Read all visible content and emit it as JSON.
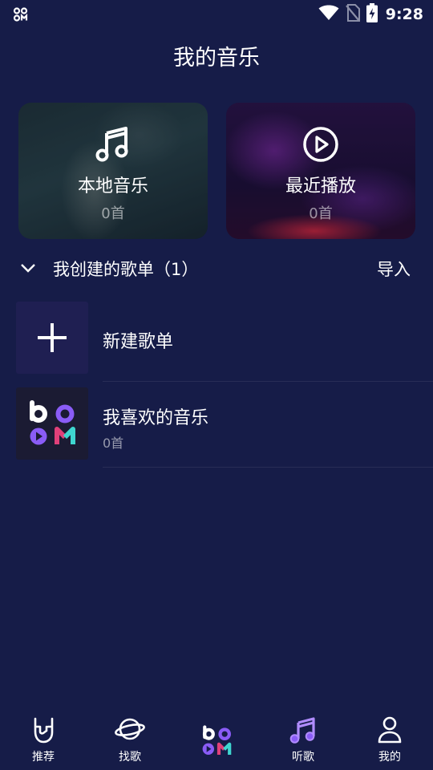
{
  "status_bar": {
    "time": "9:28",
    "icons": [
      "app-logo-icon",
      "wifi-icon",
      "no-sim-icon",
      "battery-charging-icon"
    ]
  },
  "page": {
    "title": "我的音乐"
  },
  "cards": [
    {
      "title": "本地音乐",
      "count": "0首",
      "icon": "music-note-icon"
    },
    {
      "title": "最近播放",
      "count": "0首",
      "icon": "play-circle-icon"
    }
  ],
  "section": {
    "title": "我创建的歌单（1）",
    "import_label": "导入",
    "icon": "chevron-down-icon"
  },
  "playlists": [
    {
      "title": "新建歌单",
      "icon": "plus-icon"
    },
    {
      "title": "我喜欢的音乐",
      "count": "0首",
      "icon": "boom-logo"
    }
  ],
  "bottom_nav": {
    "items": [
      {
        "label": "推荐",
        "icon": "rock-hand-icon"
      },
      {
        "label": "找歌",
        "icon": "planet-icon"
      },
      {
        "label": "",
        "icon": "boom-logo"
      },
      {
        "label": "听歌",
        "icon": "music-note-icon",
        "active": true
      },
      {
        "label": "我的",
        "icon": "user-icon"
      }
    ]
  },
  "colors": {
    "background": "#161c48",
    "accent_purple": "#8a5cf6",
    "accent_pink": "#e0407a",
    "accent_teal": "#3fd6d0"
  }
}
